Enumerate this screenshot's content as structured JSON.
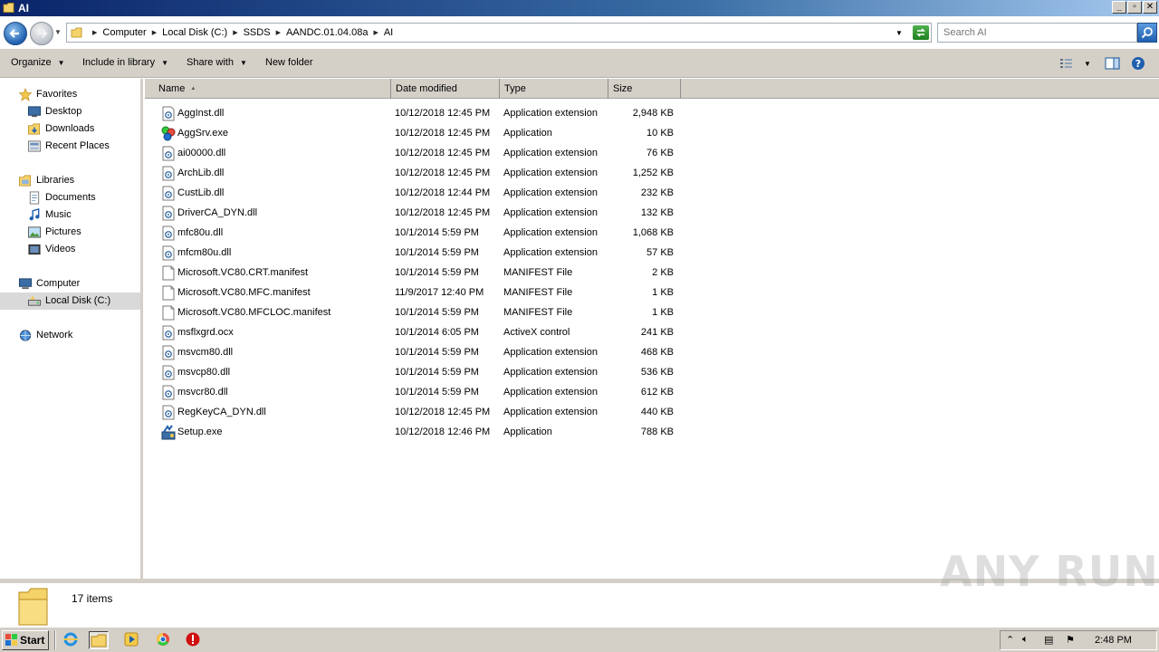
{
  "window": {
    "title": "AI",
    "controls": {
      "minimize": "_",
      "maximize": "▫",
      "close": "✕"
    }
  },
  "address": {
    "breadcrumbs": [
      "Computer",
      "Local Disk (C:)",
      "SSDS",
      "AANDC.01.04.08a",
      "AI"
    ],
    "search_placeholder": "Search AI"
  },
  "toolbar": {
    "organize": "Organize",
    "include_in_library": "Include in library",
    "share_with": "Share with",
    "new_folder": "New folder"
  },
  "nav": {
    "favorites": "Favorites",
    "desktop": "Desktop",
    "downloads": "Downloads",
    "recent_places": "Recent Places",
    "libraries": "Libraries",
    "documents": "Documents",
    "music": "Music",
    "pictures": "Pictures",
    "videos": "Videos",
    "computer": "Computer",
    "local_disk": "Local Disk (C:)",
    "network": "Network"
  },
  "columns": {
    "name": "Name",
    "date_modified": "Date modified",
    "type": "Type",
    "size": "Size"
  },
  "files": [
    {
      "name": "AggInst.dll",
      "date": "10/12/2018 12:45 PM",
      "type": "Application extension",
      "size": "2,948 KB",
      "icon": "dll-icon"
    },
    {
      "name": "AggSrv.exe",
      "date": "10/12/2018 12:45 PM",
      "type": "Application",
      "size": "10 KB",
      "icon": "app-icon"
    },
    {
      "name": "ai00000.dll",
      "date": "10/12/2018 12:45 PM",
      "type": "Application extension",
      "size": "76 KB",
      "icon": "dll-icon"
    },
    {
      "name": "ArchLib.dll",
      "date": "10/12/2018 12:45 PM",
      "type": "Application extension",
      "size": "1,252 KB",
      "icon": "dll-icon"
    },
    {
      "name": "CustLib.dll",
      "date": "10/12/2018 12:44 PM",
      "type": "Application extension",
      "size": "232 KB",
      "icon": "dll-icon"
    },
    {
      "name": "DriverCA_DYN.dll",
      "date": "10/12/2018 12:45 PM",
      "type": "Application extension",
      "size": "132 KB",
      "icon": "dll-icon"
    },
    {
      "name": "mfc80u.dll",
      "date": "10/1/2014 5:59 PM",
      "type": "Application extension",
      "size": "1,068 KB",
      "icon": "dll-icon"
    },
    {
      "name": "mfcm80u.dll",
      "date": "10/1/2014 5:59 PM",
      "type": "Application extension",
      "size": "57 KB",
      "icon": "dll-icon"
    },
    {
      "name": "Microsoft.VC80.CRT.manifest",
      "date": "10/1/2014 5:59 PM",
      "type": "MANIFEST File",
      "size": "2 KB",
      "icon": "file-icon"
    },
    {
      "name": "Microsoft.VC80.MFC.manifest",
      "date": "11/9/2017 12:40 PM",
      "type": "MANIFEST File",
      "size": "1 KB",
      "icon": "file-icon"
    },
    {
      "name": "Microsoft.VC80.MFCLOC.manifest",
      "date": "10/1/2014 5:59 PM",
      "type": "MANIFEST File",
      "size": "1 KB",
      "icon": "file-icon"
    },
    {
      "name": "msflxgrd.ocx",
      "date": "10/1/2014 6:05 PM",
      "type": "ActiveX control",
      "size": "241 KB",
      "icon": "dll-icon"
    },
    {
      "name": "msvcm80.dll",
      "date": "10/1/2014 5:59 PM",
      "type": "Application extension",
      "size": "468 KB",
      "icon": "dll-icon"
    },
    {
      "name": "msvcp80.dll",
      "date": "10/1/2014 5:59 PM",
      "type": "Application extension",
      "size": "536 KB",
      "icon": "dll-icon"
    },
    {
      "name": "msvcr80.dll",
      "date": "10/1/2014 5:59 PM",
      "type": "Application extension",
      "size": "612 KB",
      "icon": "dll-icon"
    },
    {
      "name": "RegKeyCA_DYN.dll",
      "date": "10/12/2018 12:45 PM",
      "type": "Application extension",
      "size": "440 KB",
      "icon": "dll-icon"
    },
    {
      "name": "Setup.exe",
      "date": "10/12/2018 12:46 PM",
      "type": "Application",
      "size": "788 KB",
      "icon": "setup-icon"
    }
  ],
  "details": {
    "item_count": "17 items"
  },
  "watermark": "ANY RUN",
  "taskbar": {
    "start": "Start",
    "clock": "2:48 PM"
  },
  "colors": {
    "title_gradient_start": "#0a246a",
    "chrome": "#d4d0c8",
    "selection": "#d9d9d9"
  }
}
